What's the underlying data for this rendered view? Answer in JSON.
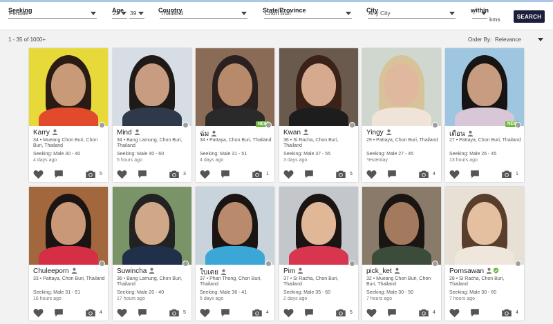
{
  "search": {
    "seeking_label": "Seeking",
    "seeking_value": "Female",
    "age_label": "Age",
    "age_min": "22",
    "age_max": "39",
    "country_label": "Country",
    "country_value": "Thailand",
    "state_label": "State/Province",
    "state_value": "Chon Buri",
    "city_label": "City",
    "city_value": "Any City",
    "within_label": "within",
    "within_value": "-",
    "within_unit": "kms",
    "search_button": "SEARCH"
  },
  "results": {
    "count_text": "1 - 35 of 1000+",
    "order_by_label": "Order By:",
    "order_by_value": "Relevance"
  },
  "colors": {
    "accent": "#1b1f3a",
    "new_badge": "#6fba3c",
    "verified": "#6fba3c",
    "icon": "#555555"
  },
  "profiles": [
    {
      "name": "Karry",
      "location": "34 • Mueang Chon Buri, Chon Buri, Thailand",
      "seeking": "Seeking: Male 30 - 40",
      "last_active": "4 days ago",
      "photos": "5",
      "is_new": false,
      "verified": false
    },
    {
      "name": "Mind",
      "location": "34 • Bang Lamung, Chon Buri, Thailand",
      "seeking": "Seeking: Male 40 - 60",
      "last_active": "5 hours ago",
      "photos": "3",
      "is_new": false,
      "verified": false
    },
    {
      "name": "ฉ่ม",
      "location": "34 • Pattaya, Chon Buri, Thailand",
      "seeking": "Seeking: Male 31 - 51",
      "last_active": "4 days ago",
      "photos": "1",
      "is_new": true,
      "verified": false
    },
    {
      "name": "Kwan",
      "location": "36 • Si Racha, Chon Buri, Thailand",
      "seeking": "Seeking: Male 37 - 55",
      "last_active": "3 days ago",
      "photos": "5",
      "is_new": false,
      "verified": false
    },
    {
      "name": "Yingy",
      "location": "29 • Pattaya, Chon Buri, Thailand",
      "seeking": "Seeking: Male 27 - 45",
      "last_active": "Yesterday",
      "photos": "4",
      "is_new": false,
      "verified": false
    },
    {
      "name": "เดือน",
      "location": "27 • Pattaya, Chon Buri, Thailand",
      "seeking": "Seeking: Male 26 - 45",
      "last_active": "13 hours ago",
      "photos": "1",
      "is_new": true,
      "verified": false
    },
    {
      "name": "Chuleeporn",
      "location": "33 • Pattaya, Chon Buri, Thailand",
      "seeking": "Seeking: Male 31 - 51",
      "last_active": "16 hours ago",
      "photos": "4",
      "is_new": false,
      "verified": false
    },
    {
      "name": "Suwincha",
      "location": "36 • Bang Lamung, Chon Buri, Thailand",
      "seeking": "Seeking: Male 20 - 40",
      "last_active": "17 hours ago",
      "photos": "5",
      "is_new": false,
      "verified": false
    },
    {
      "name": "ใบเตย",
      "location": "37 • Phan Thong, Chon Buri, Thailand",
      "seeking": "Seeking: Male 36 - 41",
      "last_active": "6 days ago",
      "photos": "4",
      "is_new": false,
      "verified": false
    },
    {
      "name": "Pim",
      "location": "37 • Si Racha, Chon Buri, Thailand",
      "seeking": "Seeking: Male 35 - 60",
      "last_active": "2 days ago",
      "photos": "5",
      "is_new": false,
      "verified": false
    },
    {
      "name": "pick_ket",
      "location": "32 • Mueang Chon Buri, Chon Buri, Thailand",
      "seeking": "Seeking: Male 30 - 50",
      "last_active": "7 hours ago",
      "photos": "4",
      "is_new": false,
      "verified": false
    },
    {
      "name": "Pornsawan",
      "location": "28 • Si Racha, Chon Buri, Thailand",
      "seeking": "Seeking: Male 30 - 60",
      "last_active": "7 hours ago",
      "photos": "4",
      "is_new": false,
      "verified": true
    }
  ]
}
